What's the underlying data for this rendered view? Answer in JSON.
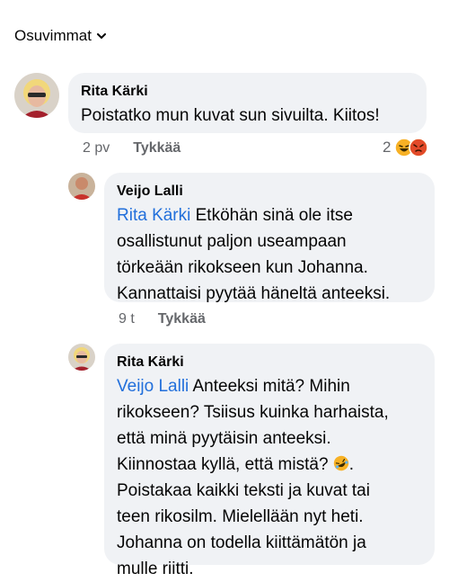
{
  "sort": {
    "label": "Osuvimmat"
  },
  "comments": [
    {
      "author": "Rita Kärki",
      "text": "Poistatko mun kuvat sun sivuilta. Kiitos!",
      "age": "2 pv",
      "like_label": "Tykkää",
      "reaction_count": "2",
      "reactions": [
        "haha-icon",
        "angry-icon"
      ]
    },
    {
      "author": "Veijo Lalli",
      "mention": "Rita Kärki",
      "text_lines": [
        " Etköhän sinä ole itse",
        "osallistunut paljon useampaan",
        "törkeään rikokseen kun Johanna.",
        "Kannattaisi pyytää häneltä anteeksi."
      ],
      "age": "9 t",
      "like_label": "Tykkää"
    },
    {
      "author": "Rita Kärki",
      "mention": "Veijo Lalli",
      "text_lines": [
        " Anteeksi mitä? Mihin",
        "rikokseen? Tsiisus kuinka harhaista,",
        "että minä pyytäisin anteeksi.",
        "Kiinnostaa kyllä, että mistä? ",
        "Poistakaa kaikki teksti ja kuvat tai",
        "teen rikosilm. Mielellään nyt heti.",
        "Johanna on todella kiittämätön ja",
        "mulle riitti."
      ],
      "line4_tail": "."
    }
  ],
  "colors": {
    "bubble": "#f0f2f5",
    "meta": "#65676b",
    "mention": "#216fdb"
  }
}
